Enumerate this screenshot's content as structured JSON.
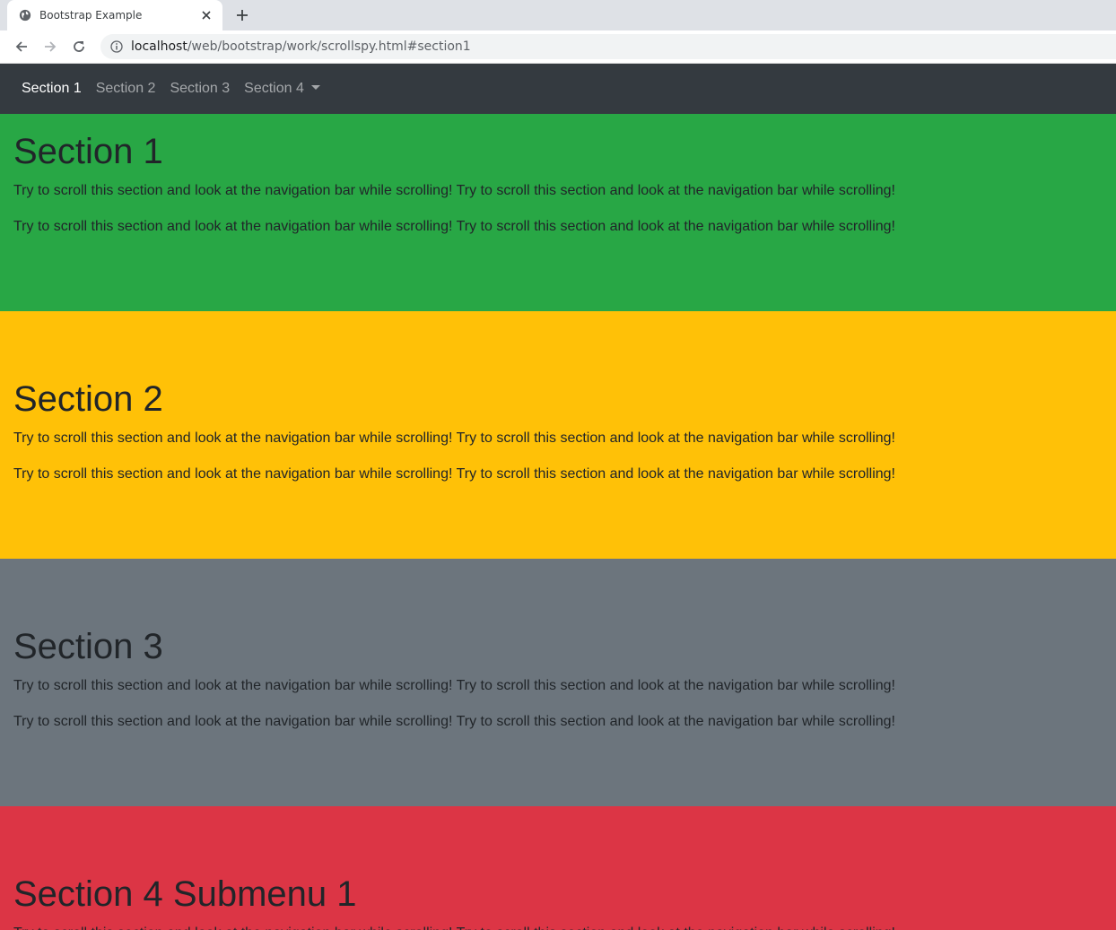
{
  "browser": {
    "tab_title": "Bootstrap Example",
    "url_host": "localhost",
    "url_path": "/web/bootstrap/work/scrollspy.html#section1"
  },
  "navbar": {
    "items": [
      {
        "label": "Section 1",
        "active": true
      },
      {
        "label": "Section 2"
      },
      {
        "label": "Section 3"
      },
      {
        "label": "Section 4",
        "dropdown": true
      }
    ]
  },
  "sections": [
    {
      "title": "Section 1",
      "color": "#28a745",
      "paragraphs": [
        "Try to scroll this section and look at the navigation bar while scrolling! Try to scroll this section and look at the navigation bar while scrolling!",
        "Try to scroll this section and look at the navigation bar while scrolling! Try to scroll this section and look at the navigation bar while scrolling!"
      ]
    },
    {
      "title": "Section 2",
      "color": "#ffc107",
      "paragraphs": [
        "Try to scroll this section and look at the navigation bar while scrolling! Try to scroll this section and look at the navigation bar while scrolling!",
        "Try to scroll this section and look at the navigation bar while scrolling! Try to scroll this section and look at the navigation bar while scrolling!"
      ]
    },
    {
      "title": "Section 3",
      "color": "#6c757d",
      "paragraphs": [
        "Try to scroll this section and look at the navigation bar while scrolling! Try to scroll this section and look at the navigation bar while scrolling!",
        "Try to scroll this section and look at the navigation bar while scrolling! Try to scroll this section and look at the navigation bar while scrolling!"
      ]
    },
    {
      "title": "Section 4 Submenu 1",
      "color": "#dc3545",
      "paragraphs": [
        "Try to scroll this section and look at the navigation bar while scrolling! Try to scroll this section and look at the navigation bar while scrolling!"
      ]
    }
  ]
}
